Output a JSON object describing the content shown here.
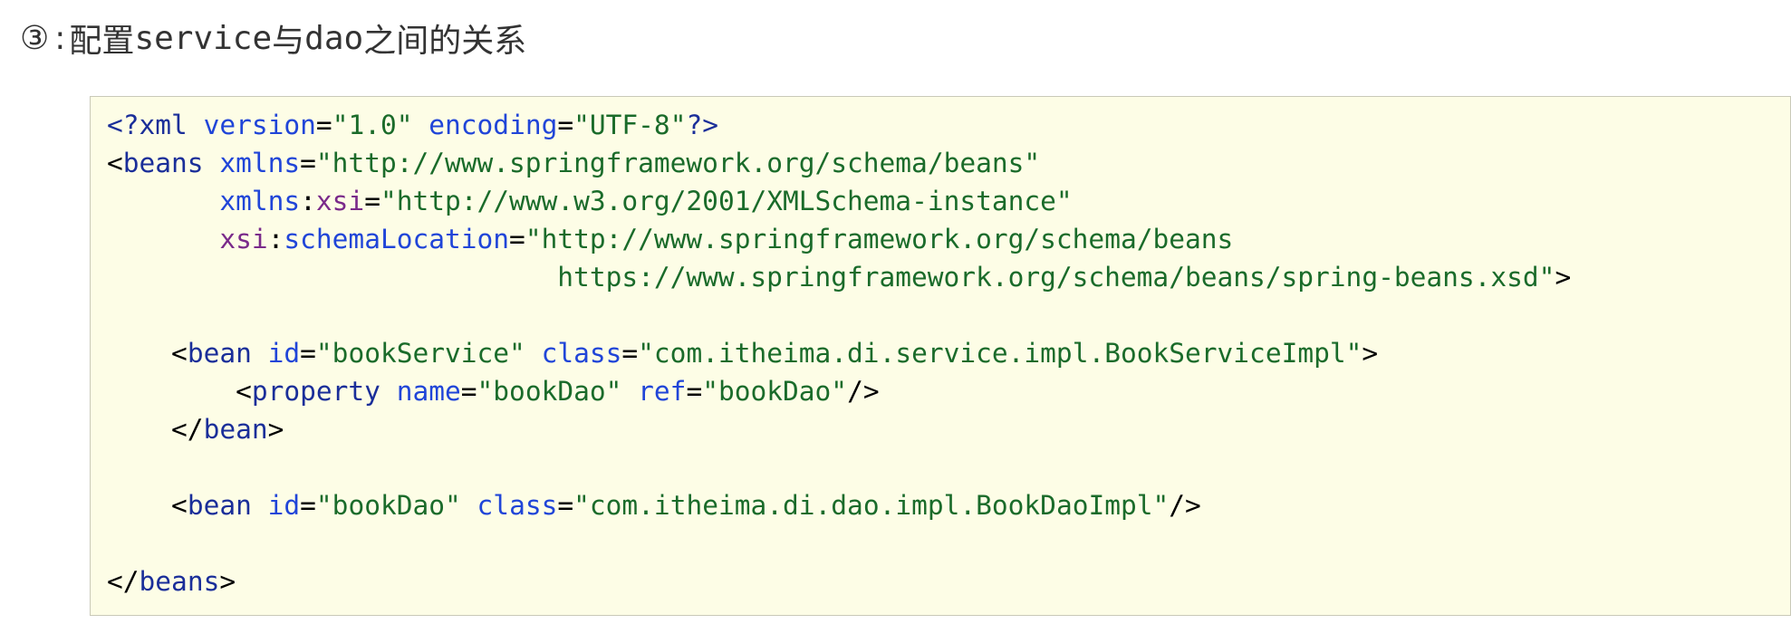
{
  "heading": {
    "number": "③",
    "separator": ":",
    "part1": "配置",
    "part2": "service",
    "part3": "与",
    "part4": "dao",
    "part5": "之间的关系"
  },
  "code_lines": [
    [
      {
        "cls": "pi",
        "text": "<?"
      },
      {
        "cls": "tag",
        "text": "xml"
      },
      {
        "cls": "punct",
        "text": " "
      },
      {
        "cls": "attr",
        "text": "version"
      },
      {
        "cls": "punct",
        "text": "="
      },
      {
        "cls": "val",
        "text": "\"1.0\""
      },
      {
        "cls": "punct",
        "text": " "
      },
      {
        "cls": "attr",
        "text": "encoding"
      },
      {
        "cls": "punct",
        "text": "="
      },
      {
        "cls": "val",
        "text": "\"UTF-8\""
      },
      {
        "cls": "pi",
        "text": "?>"
      }
    ],
    [
      {
        "cls": "punct",
        "text": "<"
      },
      {
        "cls": "tag",
        "text": "beans"
      },
      {
        "cls": "punct",
        "text": " "
      },
      {
        "cls": "attr",
        "text": "xmlns"
      },
      {
        "cls": "punct",
        "text": "="
      },
      {
        "cls": "val",
        "text": "\"http://www.springframework.org/schema/beans\""
      }
    ],
    [
      {
        "cls": "punct",
        "text": "       "
      },
      {
        "cls": "attr",
        "text": "xmlns"
      },
      {
        "cls": "punct",
        "text": ":"
      },
      {
        "cls": "ns",
        "text": "xsi"
      },
      {
        "cls": "punct",
        "text": "="
      },
      {
        "cls": "val",
        "text": "\"http://www.w3.org/2001/XMLSchema-instance\""
      }
    ],
    [
      {
        "cls": "punct",
        "text": "       "
      },
      {
        "cls": "ns",
        "text": "xsi"
      },
      {
        "cls": "punct",
        "text": ":"
      },
      {
        "cls": "attr",
        "text": "schemaLocation"
      },
      {
        "cls": "punct",
        "text": "="
      },
      {
        "cls": "val",
        "text": "\"http://www.springframework.org/schema/beans"
      }
    ],
    [
      {
        "cls": "val",
        "text": "                            https://www.springframework.org/schema/beans/spring-beans.xsd\""
      },
      {
        "cls": "punct",
        "text": ">"
      }
    ],
    [],
    [
      {
        "cls": "punct",
        "text": "    <"
      },
      {
        "cls": "tag",
        "text": "bean"
      },
      {
        "cls": "punct",
        "text": " "
      },
      {
        "cls": "attr",
        "text": "id"
      },
      {
        "cls": "punct",
        "text": "="
      },
      {
        "cls": "val",
        "text": "\"bookService\""
      },
      {
        "cls": "punct",
        "text": " "
      },
      {
        "cls": "attr",
        "text": "class"
      },
      {
        "cls": "punct",
        "text": "="
      },
      {
        "cls": "val",
        "text": "\"com.itheima.di.service.impl.BookServiceImpl\""
      },
      {
        "cls": "punct",
        "text": ">"
      }
    ],
    [
      {
        "cls": "punct",
        "text": "        <"
      },
      {
        "cls": "tag",
        "text": "property"
      },
      {
        "cls": "punct",
        "text": " "
      },
      {
        "cls": "attr",
        "text": "name"
      },
      {
        "cls": "punct",
        "text": "="
      },
      {
        "cls": "val",
        "text": "\"bookDao\""
      },
      {
        "cls": "punct",
        "text": " "
      },
      {
        "cls": "attr",
        "text": "ref"
      },
      {
        "cls": "punct",
        "text": "="
      },
      {
        "cls": "val",
        "text": "\"bookDao\""
      },
      {
        "cls": "punct",
        "text": "/>"
      }
    ],
    [
      {
        "cls": "punct",
        "text": "    </"
      },
      {
        "cls": "tag",
        "text": "bean"
      },
      {
        "cls": "punct",
        "text": ">"
      }
    ],
    [],
    [
      {
        "cls": "punct",
        "text": "    <"
      },
      {
        "cls": "tag",
        "text": "bean"
      },
      {
        "cls": "punct",
        "text": " "
      },
      {
        "cls": "attr",
        "text": "id"
      },
      {
        "cls": "punct",
        "text": "="
      },
      {
        "cls": "val",
        "text": "\"bookDao\""
      },
      {
        "cls": "punct",
        "text": " "
      },
      {
        "cls": "attr",
        "text": "class"
      },
      {
        "cls": "punct",
        "text": "="
      },
      {
        "cls": "val",
        "text": "\"com.itheima.di.dao.impl.BookDaoImpl\""
      },
      {
        "cls": "punct",
        "text": "/>"
      }
    ],
    [],
    [
      {
        "cls": "punct",
        "text": "</"
      },
      {
        "cls": "tag",
        "text": "beans"
      },
      {
        "cls": "punct",
        "text": ">"
      }
    ]
  ]
}
